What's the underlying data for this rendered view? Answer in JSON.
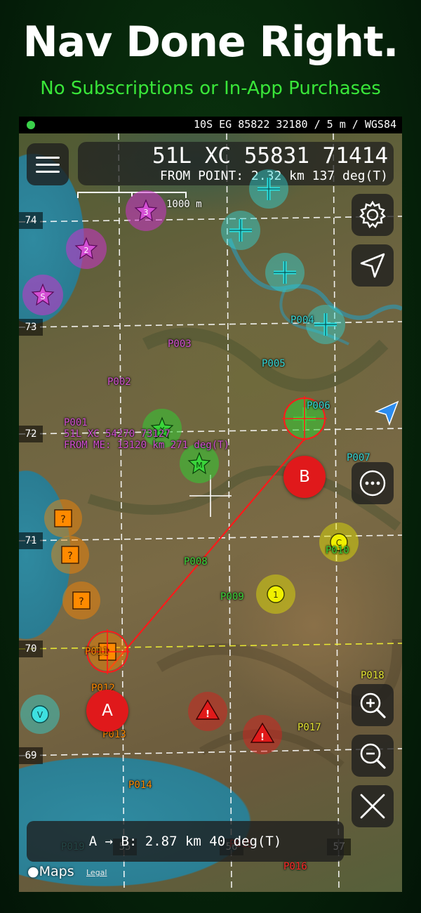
{
  "headline": "Nav Done Right.",
  "subheadline": "No Subscriptions or In-App Purchases",
  "status_bar": {
    "gps_status_color": "#3ad14a",
    "text": "10S EG 85822 32180 / 5 m / WGS84"
  },
  "coordinate_panel": {
    "main": "51L XC 55831 71414",
    "sub": "FROM POINT: 2.32 km 137 deg(T)"
  },
  "menu_icon": "hamburger-menu-icon",
  "scale_bar": {
    "label": "1000 m"
  },
  "grid": {
    "northing_labels": [
      "74",
      "73",
      "72",
      "71",
      "70",
      "69"
    ],
    "easting_labels": [
      "55",
      "56",
      "57"
    ]
  },
  "waypoints": [
    {
      "id": "P001",
      "type": "purple-star",
      "symbol": "S",
      "color": "#cc33cc",
      "details": [
        "51L XC 54270 73127",
        "FROM ME: 13120 km 271 deg(T)"
      ]
    },
    {
      "id": "P002",
      "type": "purple-star",
      "symbol": "2",
      "color": "#cc33cc"
    },
    {
      "id": "P003",
      "type": "purple-star",
      "symbol": "3",
      "color": "#cc33cc"
    },
    {
      "id": "P004",
      "type": "cyan-cross",
      "color": "#33d6d6"
    },
    {
      "id": "P005",
      "type": "cyan-cross",
      "color": "#33d6d6"
    },
    {
      "id": "P006",
      "type": "cyan-cross",
      "color": "#33d6d6"
    },
    {
      "id": "P007",
      "type": "cyan-cross",
      "color": "#33d6d6"
    },
    {
      "id": "P008",
      "type": "green-star",
      "symbol": "X",
      "color": "#33cc33"
    },
    {
      "id": "P009",
      "type": "green-star",
      "symbol": "M",
      "color": "#33cc33"
    },
    {
      "id": "P010",
      "type": "green-cross",
      "color": "#33cc33"
    },
    {
      "id": "P011",
      "type": "orange-square",
      "symbol": "?",
      "color": "#ff8800"
    },
    {
      "id": "P012",
      "type": "orange-square",
      "symbol": "?",
      "color": "#ff8800"
    },
    {
      "id": "P013",
      "type": "orange-square",
      "symbol": "?",
      "color": "#ff8800"
    },
    {
      "id": "P014",
      "type": "orange-square",
      "symbol": "?",
      "color": "#ff8800"
    },
    {
      "id": "P015",
      "type": "red-warning",
      "symbol": "!",
      "color": "#e01a1a"
    },
    {
      "id": "P016",
      "type": "red-warning",
      "symbol": "!",
      "color": "#e01a1a"
    },
    {
      "id": "P017",
      "type": "yellow-circle",
      "symbol": "1",
      "color": "#e6e600"
    },
    {
      "id": "P018",
      "type": "yellow-circle",
      "symbol": "C",
      "color": "#e6e600"
    },
    {
      "id": "P019",
      "type": "cyan-circle",
      "symbol": "V",
      "color": "#33d6d6"
    }
  ],
  "route": {
    "start_label": "A",
    "end_label": "B",
    "line_color": "#ff1a1a",
    "summary": "A → B: 2.87 km 40 deg(T)"
  },
  "side_buttons": {
    "settings": "gear-icon",
    "locate": "location-arrow-icon",
    "more": "more-options-icon",
    "zoom_in": "zoom-in-icon",
    "zoom_out": "zoom-out-icon",
    "close": "close-icon"
  },
  "attribution": {
    "brand": "Maps",
    "legal": "Legal"
  },
  "accent_colors": {
    "subheadline": "#39e639",
    "current_location": "#2b8cf0"
  }
}
